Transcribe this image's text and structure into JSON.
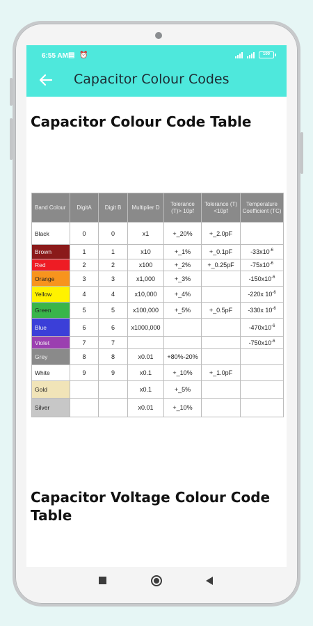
{
  "status_bar": {
    "time": "6:55 AM",
    "battery": "100"
  },
  "app_bar": {
    "title": "Capacitor Colour Codes",
    "back_icon": "arrow-left-icon"
  },
  "content": {
    "heading_1": "Capacitor Colour Code Table",
    "heading_2": "Capacitor Voltage Colour Code Table"
  },
  "table": {
    "headers": [
      "Band Colour",
      "DigitA",
      "Digit B",
      "Multiplier D",
      "Tolerance (T)> 10pf",
      "Tolerance (T)<10pf",
      "Temperature Coefficient (TC)"
    ],
    "rows": [
      {
        "band": "Black",
        "color": "#ffffff",
        "text_color": "#222222",
        "a": "0",
        "b": "0",
        "mult": "x1",
        "tol_gt": "+_20%",
        "tol_lt": "+_2.0pF",
        "tc_base": "",
        "tc_exp": ""
      },
      {
        "band": "Brown",
        "color": "#8b1a1a",
        "text_color": "#f0f0f0",
        "a": "1",
        "b": "1",
        "mult": "x10",
        "tol_gt": "+_1%",
        "tol_lt": "+_0.1pF",
        "tc_base": "-33x10",
        "tc_exp": "-6"
      },
      {
        "band": "Red",
        "color": "#ee1c24",
        "text_color": "#f0f0f0",
        "a": "2",
        "b": "2",
        "mult": "x100",
        "tol_gt": "+_2%",
        "tol_lt": "+_0.25pF",
        "tc_base": "-75x10",
        "tc_exp": "-6"
      },
      {
        "band": "Orange",
        "color": "#f7941d",
        "text_color": "#222222",
        "a": "3",
        "b": "3",
        "mult": "x1,000",
        "tol_gt": "+_3%",
        "tol_lt": "",
        "tc_base": "-150x10",
        "tc_exp": "-6"
      },
      {
        "band": "Yellow",
        "color": "#fff200",
        "text_color": "#222222",
        "a": "4",
        "b": "4",
        "mult": "x10,000",
        "tol_gt": "+_4%",
        "tol_lt": "",
        "tc_base": "-220x 10",
        "tc_exp": "-6"
      },
      {
        "band": "Green",
        "color": "#39b54a",
        "text_color": "#222222",
        "a": "5",
        "b": "5",
        "mult": "x100,000",
        "tol_gt": "+_5%",
        "tol_lt": "+_0.5pF",
        "tc_base": "-330x 10",
        "tc_exp": "-6"
      },
      {
        "band": "Blue",
        "color": "#3b3fd8",
        "text_color": "#f0f0f0",
        "a": "6",
        "b": "6",
        "mult": "x1000,000",
        "tol_gt": "",
        "tol_lt": "",
        "tc_base": "-470x10",
        "tc_exp": "-6"
      },
      {
        "band": "Violet",
        "color": "#9b3fb0",
        "text_color": "#f0f0f0",
        "a": "7",
        "b": "7",
        "mult": "",
        "tol_gt": "",
        "tol_lt": "",
        "tc_base": "-750x10",
        "tc_exp": "-6"
      },
      {
        "band": "Grey",
        "color": "#8a8a8a",
        "text_color": "#f0f0f0",
        "a": "8",
        "b": "8",
        "mult": "x0.01",
        "tol_gt": "+80%-20%",
        "tol_lt": "",
        "tc_base": "",
        "tc_exp": ""
      },
      {
        "band": "White",
        "color": "#ffffff",
        "text_color": "#222222",
        "a": "9",
        "b": "9",
        "mult": "x0.1",
        "tol_gt": "+_10%",
        "tol_lt": "+_1.0pF",
        "tc_base": "",
        "tc_exp": ""
      },
      {
        "band": "Gold",
        "color": "#f1e4b8",
        "text_color": "#222222",
        "a": "",
        "b": "",
        "mult": "x0.1",
        "tol_gt": "+_5%",
        "tol_lt": "",
        "tc_base": "",
        "tc_exp": ""
      },
      {
        "band": "Silver",
        "color": "#c7c7c7",
        "text_color": "#222222",
        "a": "",
        "b": "",
        "mult": "x0.01",
        "tol_gt": "+_10%",
        "tol_lt": "",
        "tc_base": "",
        "tc_exp": ""
      }
    ]
  },
  "nav_bar": {
    "icons": [
      "recent-apps-icon",
      "home-icon",
      "back-icon"
    ]
  }
}
